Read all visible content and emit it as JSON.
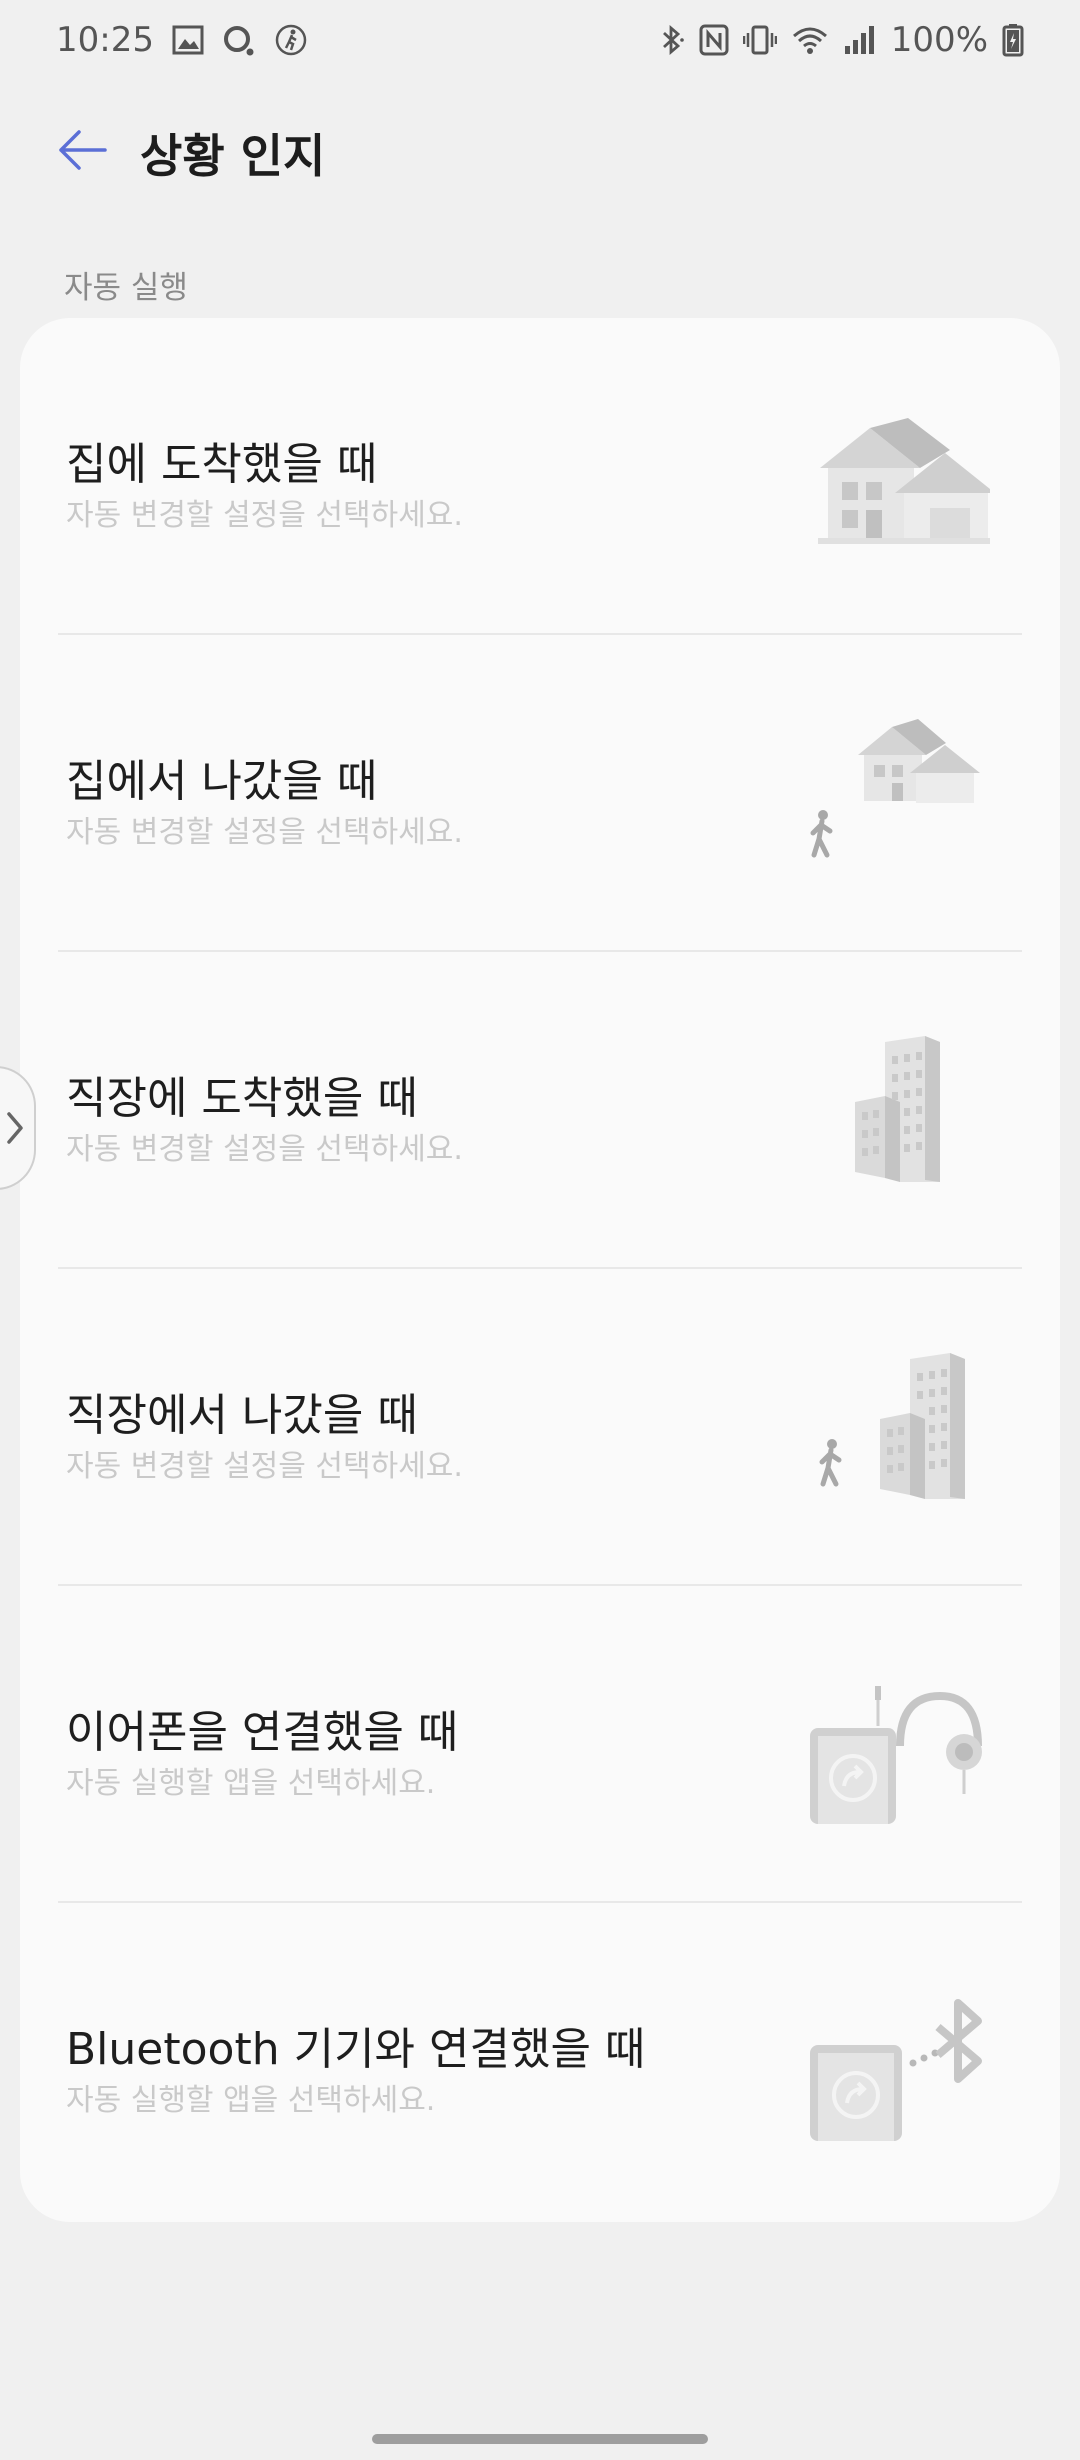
{
  "status_bar": {
    "time": "10:25",
    "battery": "100%",
    "left_icons": [
      "gallery-icon",
      "circle-icon",
      "walking-icon"
    ],
    "right_icons": [
      "bluetooth-icon",
      "nfc-icon",
      "vibrate-icon",
      "wifi-icon",
      "signal-icon",
      "battery-icon"
    ]
  },
  "header": {
    "back_icon": "back-arrow-icon",
    "title": "상황 인지"
  },
  "section": {
    "label": "자동 실행"
  },
  "items": [
    {
      "title": "집에 도착했을 때",
      "subtitle": "자동 변경할 설정을 선택하세요.",
      "icon": "house-icon"
    },
    {
      "title": "집에서 나갔을 때",
      "subtitle": "자동 변경할 설정을 선택하세요.",
      "icon": "house-walking-person-icon"
    },
    {
      "title": "직장에 도착했을 때",
      "subtitle": "자동 변경할 설정을 선택하세요.",
      "icon": "office-building-icon"
    },
    {
      "title": "직장에서 나갔을 때",
      "subtitle": "자동 변경할 설정을 선택하세요.",
      "icon": "office-walking-person-icon"
    },
    {
      "title": "이어폰을 연결했을 때",
      "subtitle": "자동 실행할 앱을 선택하세요.",
      "icon": "phone-headphones-icon"
    },
    {
      "title": "Bluetooth 기기와 연결했을 때",
      "subtitle": "자동 실행할 앱을 선택하세요.",
      "icon": "phone-bluetooth-icon"
    }
  ],
  "colors": {
    "accent": "#5b6fd6",
    "background": "#f0f0f0",
    "card": "#fafafa",
    "subtitle": "#c9c9c9"
  }
}
